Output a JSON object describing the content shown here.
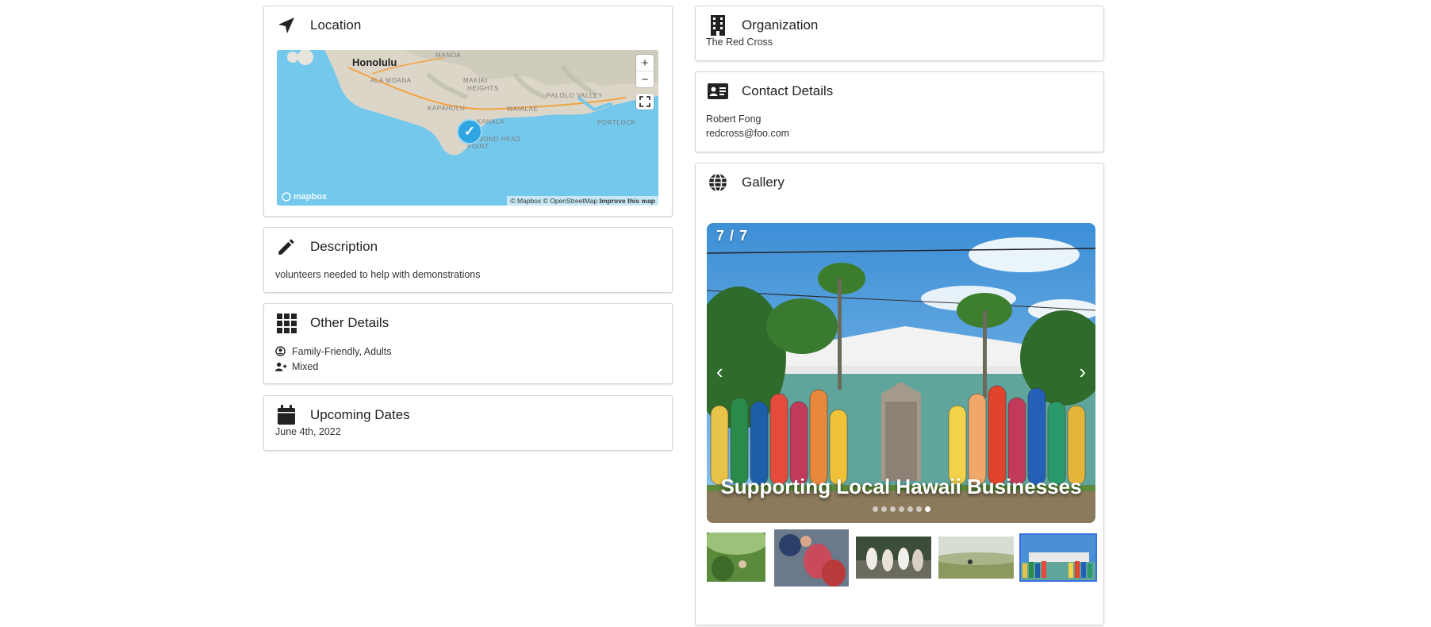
{
  "location": {
    "title": "Location",
    "icon": "location-arrow-icon",
    "map": {
      "city_label": "Honolulu",
      "area_labels": [
        "MANOA",
        "ALA MOANA",
        "MAKIKI",
        "HEIGHTS",
        "PALOLO VALLEY",
        "KAPAHULU",
        "KAHALA",
        "WAIALAE",
        "DIAMOND HEAD",
        "POINT",
        "PORTLOCK"
      ],
      "zoom_in": "+",
      "zoom_out": "−",
      "attribution": "© Mapbox © OpenStreetMap",
      "improve": "Improve this map",
      "logo": "mapbox",
      "marker": "✓"
    }
  },
  "description": {
    "title": "Description",
    "icon": "pencil-icon",
    "text": "volunteers needed to help with demonstrations"
  },
  "other_details": {
    "title": "Other Details",
    "icon": "grid-icon",
    "rows": [
      {
        "icon": "user-circle-icon",
        "text": "Family-Friendly, Adults"
      },
      {
        "icon": "user-plus-icon",
        "text": "Mixed"
      }
    ]
  },
  "upcoming_dates": {
    "title": "Upcoming Dates",
    "icon": "calendar-icon",
    "date": "June 4th, 2022"
  },
  "organization": {
    "title": "Organization",
    "icon": "building-icon",
    "name": "The Red Cross"
  },
  "contact": {
    "title": "Contact Details",
    "icon": "id-card-icon",
    "name": "Robert Fong",
    "email": "redcross@foo.com"
  },
  "gallery": {
    "title": "Gallery",
    "icon": "globe-icon",
    "counter": "7 / 7",
    "caption": "Supporting Local Hawaii Businesses",
    "prev": "‹",
    "next": "›",
    "slide_count": 7,
    "active_slide": 7,
    "thumbnail_count": 5,
    "active_thumbnail": 5
  },
  "colors": {
    "map_water": "#74c8ec",
    "accent": "#3b6fe0",
    "marker": "#2fa5e2"
  }
}
